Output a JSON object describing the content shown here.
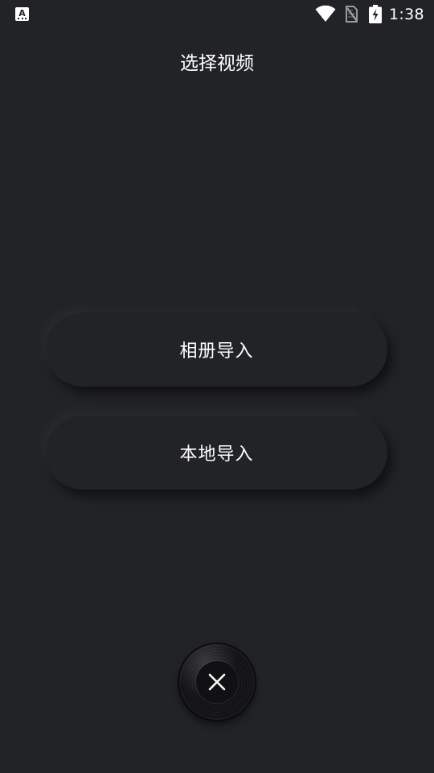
{
  "status_bar": {
    "left_icon": "font-a-icon",
    "left_icon_letter": "A",
    "wifi_icon": "wifi-icon",
    "sim_icon": "no-sim-icon",
    "battery_icon": "battery-charging-icon",
    "time": "1:38"
  },
  "page": {
    "title": "选择视频"
  },
  "actions": {
    "album_import": "相册导入",
    "local_import": "本地导入"
  },
  "close_button": {
    "icon": "close-icon"
  },
  "colors": {
    "background": "#222326",
    "text": "#ffffff"
  }
}
